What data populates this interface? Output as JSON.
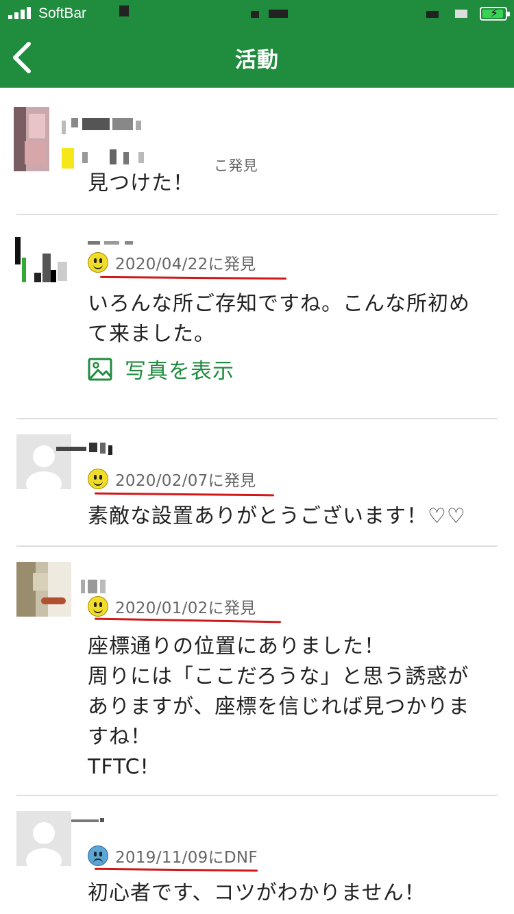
{
  "status_bar": {
    "carrier": "SoftBar"
  },
  "header": {
    "title": "活動",
    "back_icon": "chevron-left-icon"
  },
  "colors": {
    "brand": "#1f8c3e",
    "underline": "#d01818",
    "found_face": "#f1dd28",
    "dnf_face": "#5aa7d6"
  },
  "entries": [
    {
      "status": "found",
      "date_text": "こ発見",
      "comment": "見つけた！"
    },
    {
      "status": "found",
      "date_text": "2020/04/22に発見",
      "comment": "いろんな所ご存知ですね。こんな所初め\nて来ました。",
      "photo_link": "写真を表示"
    },
    {
      "status": "found",
      "date_text": "2020/02/07に発見",
      "comment": "素敵な設置ありがとうございます！♡♡"
    },
    {
      "status": "found",
      "date_text": "2020/01/02に発見",
      "comment": "座標通りの位置にありました！\n周りには「ここだろうな」と思う誘惑が\nありますが、座標を信じれば見つかりま\nすね！\nTFTC!"
    },
    {
      "status": "dnf",
      "date_text": "2019/11/09にDNF",
      "comment": "初心者です、コツがわかりません！"
    }
  ]
}
